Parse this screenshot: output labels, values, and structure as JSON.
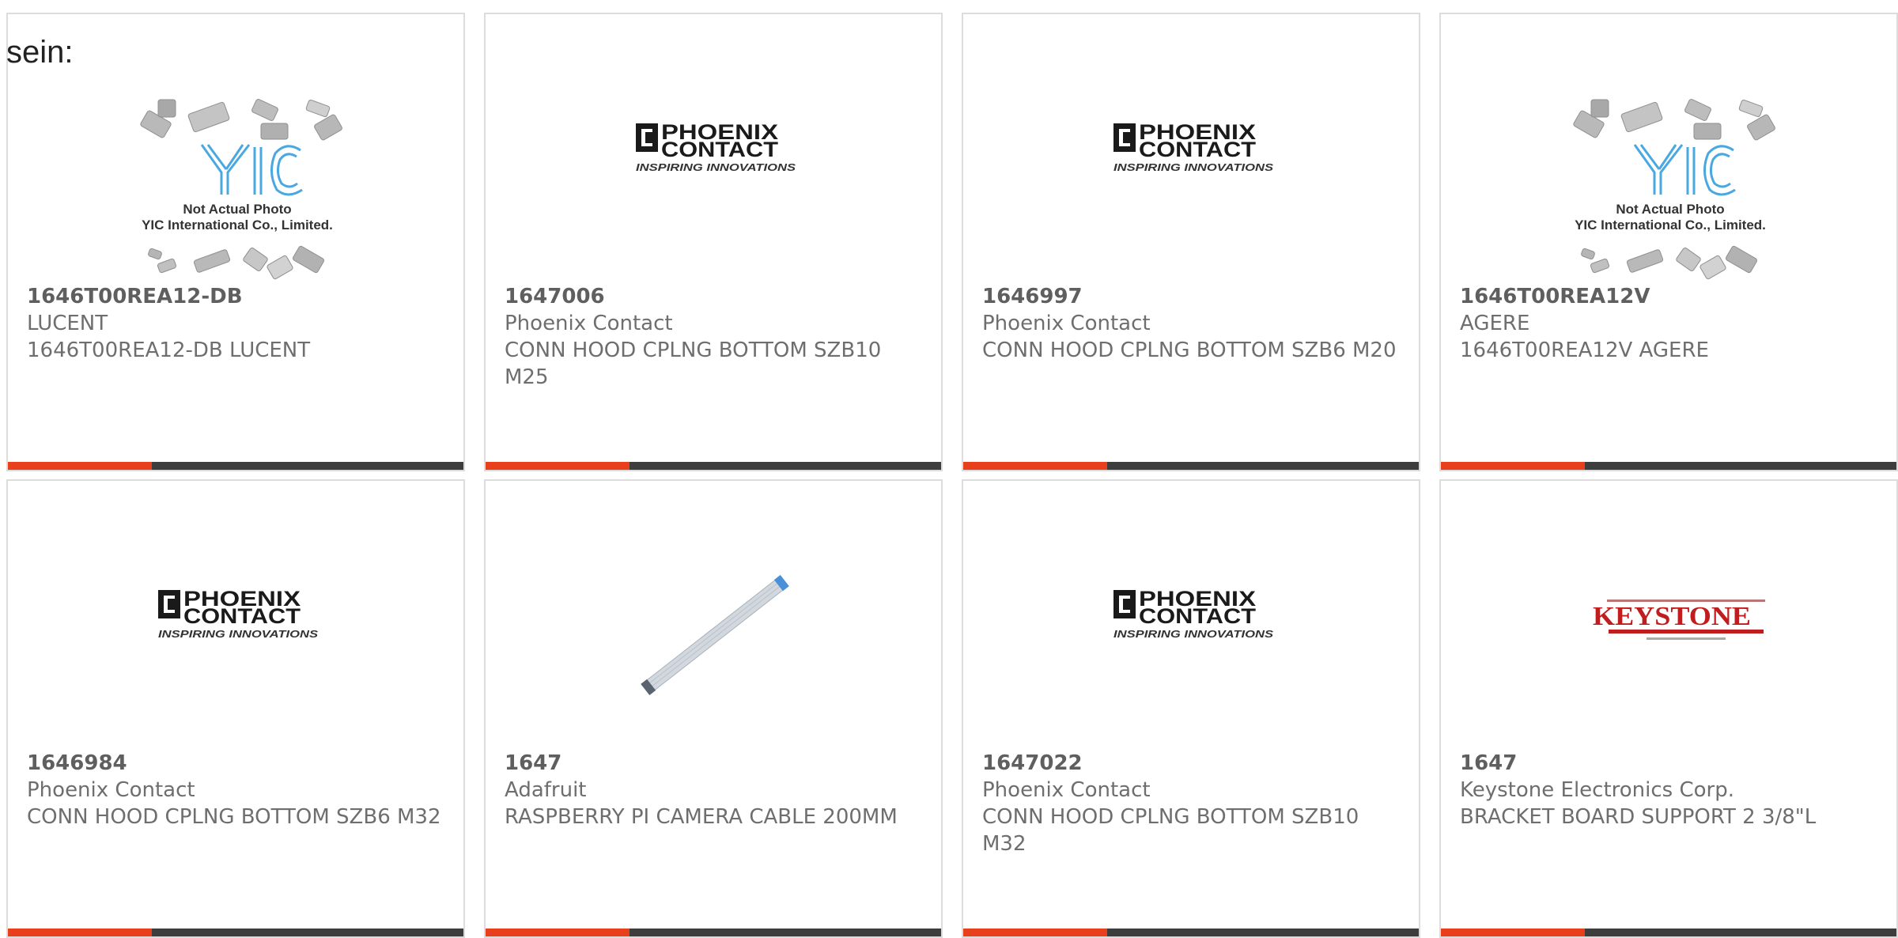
{
  "intro_text": "sein:",
  "accent_color": "#e8401c",
  "bar_color": "#3d3d3d",
  "cards": [
    {
      "part_number": "1646T00REA12-DB",
      "manufacturer": "LUCENT",
      "description": "1646T00REA12-DB LUCENT",
      "image": "yic-placeholder",
      "image_caption": [
        "Not Actual Photo",
        "YIC International Co., Limited."
      ]
    },
    {
      "part_number": "1647006",
      "manufacturer": "Phoenix Contact",
      "description": "CONN HOOD CPLNG BOTTOM SZB10 M25",
      "image": "phoenix-contact-logo",
      "logo": {
        "brand_top": "PHOENIX",
        "brand_bottom": "CONTACT",
        "tagline": "INSPIRING INNOVATIONS"
      }
    },
    {
      "part_number": "1646997",
      "manufacturer": "Phoenix Contact",
      "description": "CONN HOOD CPLNG BOTTOM SZB6 M20",
      "image": "phoenix-contact-logo",
      "logo": {
        "brand_top": "PHOENIX",
        "brand_bottom": "CONTACT",
        "tagline": "INSPIRING INNOVATIONS"
      }
    },
    {
      "part_number": "1646T00REA12V",
      "manufacturer": "AGERE",
      "description": "1646T00REA12V AGERE",
      "image": "yic-placeholder",
      "image_caption": [
        "Not Actual Photo",
        "YIC International Co., Limited."
      ]
    },
    {
      "part_number": "1646984",
      "manufacturer": "Phoenix Contact",
      "description": "CONN HOOD CPLNG BOTTOM SZB6 M32",
      "image": "phoenix-contact-logo",
      "logo": {
        "brand_top": "PHOENIX",
        "brand_bottom": "CONTACT",
        "tagline": "INSPIRING INNOVATIONS"
      }
    },
    {
      "part_number": "1647",
      "manufacturer": "Adafruit",
      "description": "RASPBERRY PI CAMERA CABLE 200MM",
      "image": "ribbon-cable-photo"
    },
    {
      "part_number": "1647022",
      "manufacturer": "Phoenix Contact",
      "description": "CONN HOOD CPLNG BOTTOM SZB10 M32",
      "image": "phoenix-contact-logo",
      "logo": {
        "brand_top": "PHOENIX",
        "brand_bottom": "CONTACT",
        "tagline": "INSPIRING INNOVATIONS"
      }
    },
    {
      "part_number": "1647",
      "manufacturer": "Keystone Electronics Corp.",
      "description": "BRACKET BOARD SUPPORT 2 3/8\"L",
      "image": "keystone-logo",
      "logo": {
        "brand": "KEYSTONE"
      }
    }
  ]
}
